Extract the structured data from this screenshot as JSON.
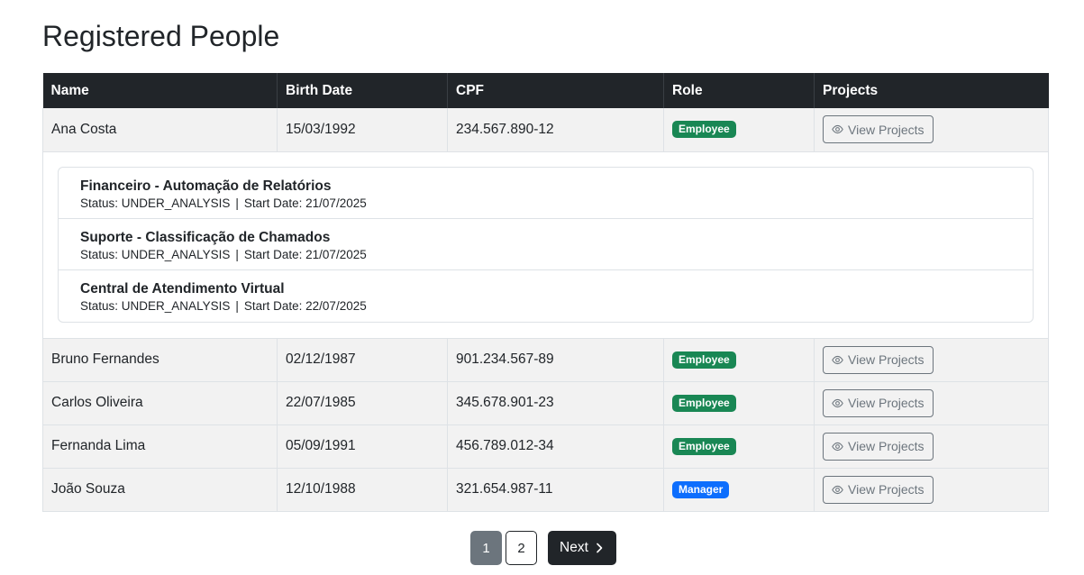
{
  "page": {
    "title": "Registered People"
  },
  "table": {
    "columns": [
      "Name",
      "Birth Date",
      "CPF",
      "Role",
      "Projects"
    ],
    "view_projects_label": "View Projects",
    "rows": [
      {
        "name": "Ana Costa",
        "birth_date": "15/03/1992",
        "cpf": "234.567.890-12",
        "role": "Employee"
      },
      {
        "name": "Bruno Fernandes",
        "birth_date": "02/12/1987",
        "cpf": "901.234.567-89",
        "role": "Employee"
      },
      {
        "name": "Carlos Oliveira",
        "birth_date": "22/07/1985",
        "cpf": "345.678.901-23",
        "role": "Employee"
      },
      {
        "name": "Fernanda Lima",
        "birth_date": "05/09/1991",
        "cpf": "456.789.012-34",
        "role": "Employee"
      },
      {
        "name": "João Souza",
        "birth_date": "12/10/1988",
        "cpf": "321.654.987-11",
        "role": "Manager"
      }
    ],
    "expanded_projects": {
      "status_label": "Status:",
      "start_label": "Start Date:",
      "separator": "|",
      "items": [
        {
          "name": "Financeiro - Automação de Relatórios",
          "status": "UNDER_ANALYSIS",
          "start_date": "21/07/2025"
        },
        {
          "name": "Suporte - Classificação de Chamados",
          "status": "UNDER_ANALYSIS",
          "start_date": "21/07/2025"
        },
        {
          "name": "Central de Atendimento Virtual",
          "status": "UNDER_ANALYSIS",
          "start_date": "22/07/2025"
        }
      ]
    }
  },
  "pagination": {
    "pages": [
      "1",
      "2"
    ],
    "current": "1",
    "next_label": "Next"
  },
  "colors": {
    "header_bg": "#212529",
    "employee_badge": "#198754",
    "manager_badge": "#0d6efd",
    "row_bg": "#f2f2f2"
  },
  "icons": {
    "view": "eye-icon",
    "next": "chevron-right-icon"
  }
}
